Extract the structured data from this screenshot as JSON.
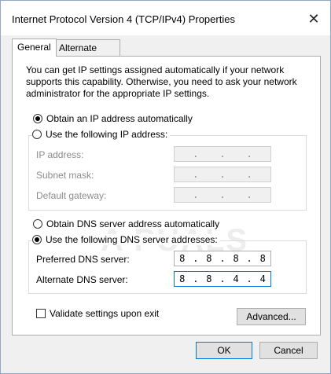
{
  "window": {
    "title": "Internet Protocol Version 4 (TCP/IPv4) Properties",
    "close_icon": "close-icon"
  },
  "tabs": [
    {
      "label": "General",
      "active": true
    },
    {
      "label": "Alternate Configuration",
      "active": false
    }
  ],
  "info_text": "You can get IP settings assigned automatically if your network supports this capability. Otherwise, you need to ask your network administrator for the appropriate IP settings.",
  "ip_mode": {
    "auto_label": "Obtain an IP address automatically",
    "manual_label": "Use the following IP address:",
    "selected": "auto"
  },
  "ip_fields": [
    {
      "label": "IP address:",
      "segments": [
        "",
        "",
        "",
        ""
      ]
    },
    {
      "label": "Subnet mask:",
      "segments": [
        "",
        "",
        "",
        ""
      ]
    },
    {
      "label": "Default gateway:",
      "segments": [
        "",
        "",
        "",
        ""
      ]
    }
  ],
  "dns_mode": {
    "auto_label": "Obtain DNS server address automatically",
    "manual_label": "Use the following DNS server addresses:",
    "selected": "manual"
  },
  "dns_fields": [
    {
      "label": "Preferred DNS server:",
      "segments": [
        "8",
        "8",
        "8",
        "8"
      ]
    },
    {
      "label": "Alternate DNS server:",
      "segments": [
        "8",
        "8",
        "4",
        "4"
      ]
    }
  ],
  "validate": {
    "label": "Validate settings upon exit",
    "checked": false
  },
  "buttons": {
    "advanced": "Advanced...",
    "ok": "OK",
    "cancel": "Cancel"
  },
  "watermark": "A PUALS"
}
